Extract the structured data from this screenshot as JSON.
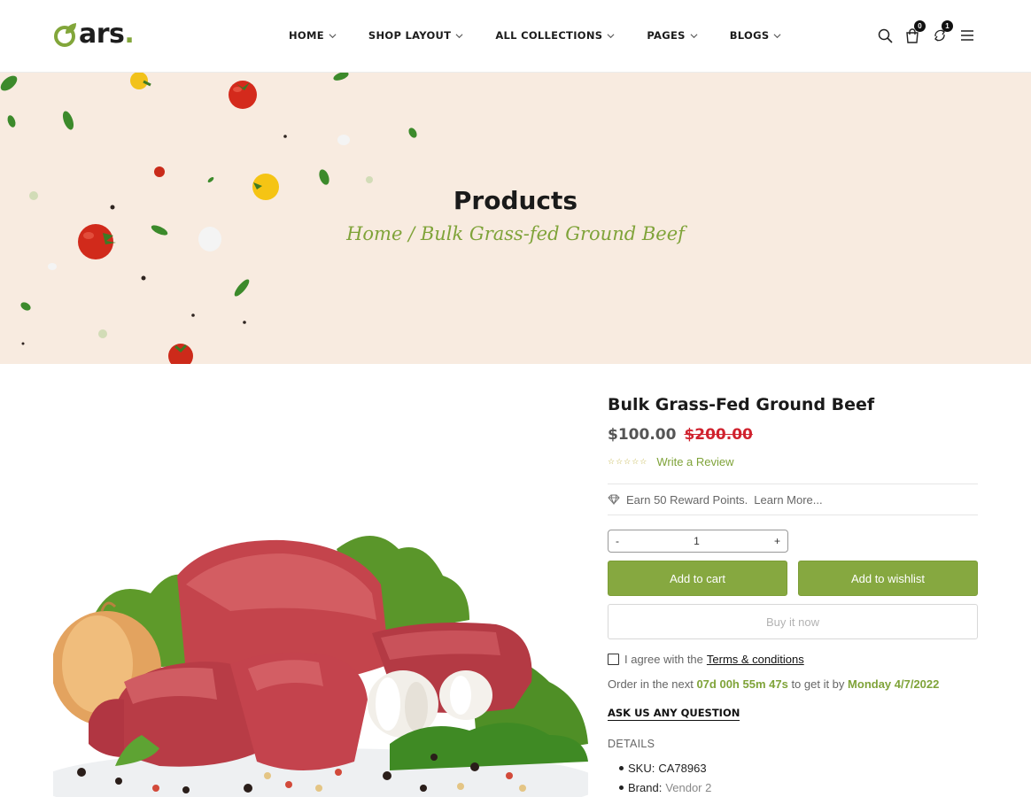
{
  "header": {
    "logo_text": "ars",
    "logo_dot": ".",
    "nav": [
      {
        "label": "HOME"
      },
      {
        "label": "SHOP LAYOUT"
      },
      {
        "label": "ALL COLLECTIONS"
      },
      {
        "label": "PAGES"
      },
      {
        "label": "BLOGS"
      }
    ],
    "cart_count": "0",
    "compare_count": "1",
    "icons": [
      "search-icon",
      "cart-icon",
      "compare-icon",
      "menu-icon"
    ]
  },
  "banner": {
    "title": "Products",
    "breadcrumb_home": "Home",
    "breadcrumb_sep": " / ",
    "breadcrumb_current": "Bulk Grass-fed Ground Beef"
  },
  "product": {
    "title": "Bulk Grass-Fed Ground Beef",
    "price": "$100.00",
    "compare_price": "$200.00",
    "rating": 0,
    "stars": "☆☆☆☆☆",
    "write_review": "Write a Review",
    "reward_text": "Earn 50 Reward Points.",
    "reward_link": "Learn More...",
    "qty_minus": "-",
    "qty_value": "1",
    "qty_plus": "+",
    "add_to_cart": "Add to cart",
    "add_to_wishlist": "Add to wishlist",
    "buy_now": "Buy it now",
    "agree_text": "I agree with the",
    "terms_link": "Terms & conditions",
    "order_prefix": "Order in the next",
    "countdown": "07d 00h 55m 47s",
    "order_mid": "to get it by",
    "delivery_date": "Monday 4/7/2022",
    "ask_question": "ASK US ANY QUESTION",
    "details_heading": "DETAILS",
    "details": [
      {
        "label": "SKU:",
        "value": "CA78963"
      },
      {
        "label": "Brand:",
        "value": "Vendor 2"
      }
    ]
  },
  "colors": {
    "accent": "#86a840",
    "sale": "#d0222e",
    "banner_bg": "#f8ebe0"
  }
}
